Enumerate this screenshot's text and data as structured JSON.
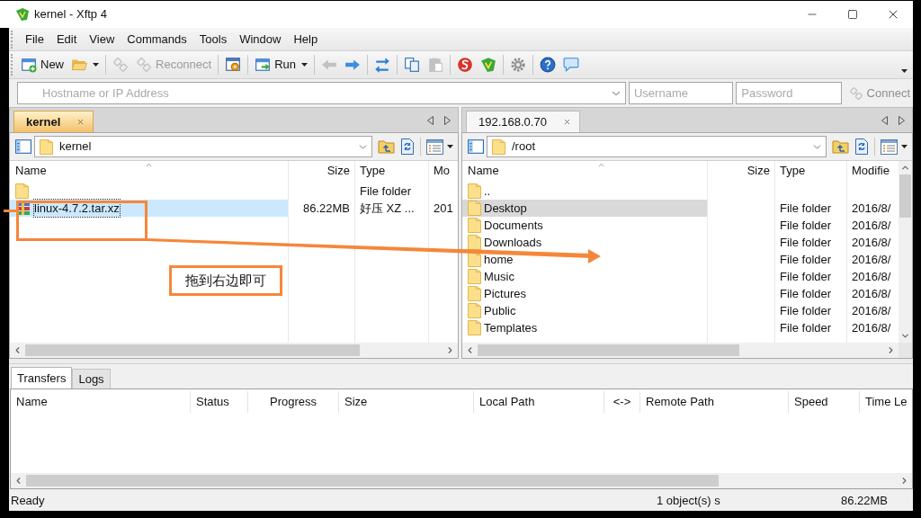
{
  "window": {
    "title": "kernel - Xftp 4"
  },
  "menu": [
    "File",
    "Edit",
    "View",
    "Commands",
    "Tools",
    "Window",
    "Help"
  ],
  "toolbar": [
    [
      {
        "label": "New",
        "dropdown": false,
        "disabled": false
      },
      {
        "dropdown": true,
        "disabled": false
      }
    ],
    [
      {
        "dropdown": false,
        "disabled": true
      },
      {
        "label": "Reconnect",
        "dropdown": false,
        "disabled": true
      }
    ],
    [
      {
        "dropdown": false,
        "disabled": false
      }
    ],
    [
      {
        "label": "Run",
        "dropdown": true,
        "disabled": false
      }
    ],
    [
      {
        "dropdown": false,
        "disabled": true
      },
      {
        "dropdown": false,
        "disabled": false
      }
    ],
    [
      {
        "dropdown": false,
        "disabled": false
      }
    ],
    [
      {
        "dropdown": false,
        "disabled": false
      },
      {
        "dropdown": false,
        "disabled": true
      }
    ],
    [
      {
        "dropdown": false,
        "disabled": false
      },
      {
        "dropdown": false,
        "disabled": false
      }
    ],
    [
      {
        "dropdown": false,
        "disabled": false
      }
    ],
    [
      {
        "dropdown": false,
        "disabled": false
      },
      {
        "dropdown": false,
        "disabled": false
      }
    ]
  ],
  "connection": {
    "host": {
      "placeholder": "Hostname or IP Address"
    },
    "username": {
      "placeholder": "Username"
    },
    "password": {
      "placeholder": "Password"
    },
    "connect": {
      "label": "Connect",
      "disabled": true
    }
  },
  "panes": [
    {
      "tab": {
        "label": "kernel",
        "selected": true
      },
      "path": "kernel",
      "columns": [
        "Name",
        "Size",
        "Type",
        "Mo"
      ],
      "rows": [
        {
          "kind": "folder",
          "type": "File folder",
          "selected": false
        },
        {
          "kind": "archive",
          "name": "linux-4.7.2.tar.xz",
          "size": "86.22MB",
          "type": "好压 XZ ...",
          "modified": "201",
          "selected": true
        }
      ]
    },
    {
      "tab": {
        "label": "192.168.0.70",
        "selected": false
      },
      "path": "/root",
      "columns": [
        "Name",
        "Size",
        "Type",
        "Modifie"
      ],
      "rows": [
        {
          "kind": "folder",
          "name": "..",
          "selected": false
        },
        {
          "kind": "folder",
          "name": "Desktop",
          "type": "File folder",
          "modified": "2016/8/",
          "selected": true
        },
        {
          "kind": "folder",
          "name": "Documents",
          "type": "File folder",
          "modified": "2016/8/",
          "selected": false
        },
        {
          "kind": "folder",
          "name": "Downloads",
          "type": "File folder",
          "modified": "2016/8/",
          "selected": false
        },
        {
          "kind": "folder",
          "name": "home",
          "type": "File folder",
          "modified": "2016/8/",
          "selected": false
        },
        {
          "kind": "folder",
          "name": "Music",
          "type": "File folder",
          "modified": "2016/8/",
          "selected": false
        },
        {
          "kind": "folder",
          "name": "Pictures",
          "type": "File folder",
          "modified": "2016/8/",
          "selected": false
        },
        {
          "kind": "folder",
          "name": "Public",
          "type": "File folder",
          "modified": "2016/8/",
          "selected": false
        },
        {
          "kind": "folder",
          "name": "Templates",
          "type": "File folder",
          "modified": "2016/8/",
          "selected": false
        }
      ]
    }
  ],
  "bottom_tabs": [
    {
      "label": "Transfers",
      "selected": true
    },
    {
      "label": "Logs",
      "selected": false
    }
  ],
  "transfers": {
    "columns": [
      "Name",
      "Status",
      "Progress",
      "Size",
      "Local Path",
      "<->",
      "Remote Path",
      "Speed",
      "Time Le"
    ]
  },
  "status_bar": [
    "Ready",
    "1 object(s) s",
    "86.22MB"
  ],
  "annotation": {
    "callout": "拖到右边即可"
  }
}
